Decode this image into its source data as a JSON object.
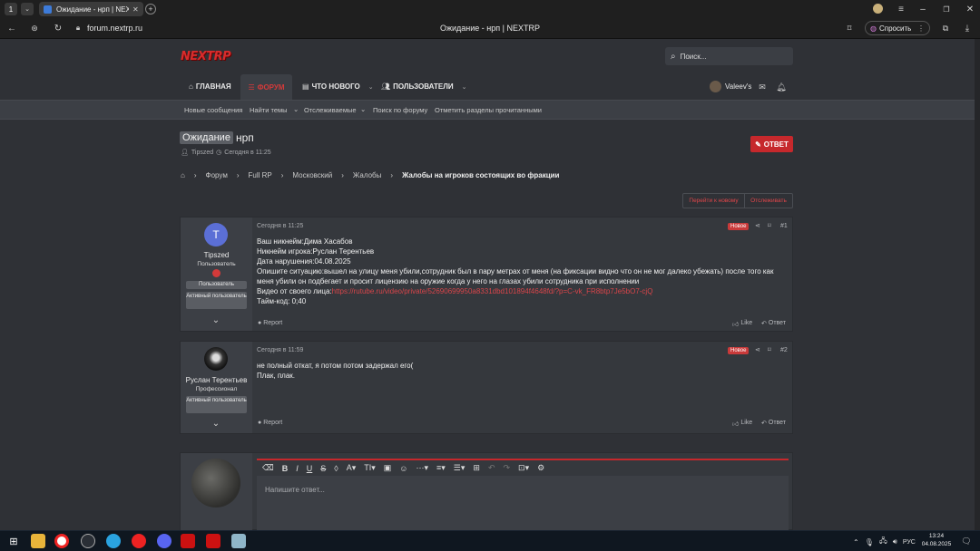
{
  "browser": {
    "tab_count": "1",
    "tab_title": "Ожидание - нрп | NEX",
    "url": "forum.nextrp.ru",
    "page_title": "Ожидание - нрп | NEXTRP",
    "ask_label": "Спросить"
  },
  "site": {
    "logo": "NEXTRP",
    "search_placeholder": "Поиск...",
    "nav": [
      {
        "label": "ГЛАВНАЯ"
      },
      {
        "label": "ФОРУМ"
      },
      {
        "label": "ЧТО НОВОГО"
      },
      {
        "label": "ПОЛЬЗОВАТЕЛИ"
      }
    ],
    "username": "Valeev's",
    "subnav": [
      "Новые сообщения",
      "Найти темы",
      "Отслеживаемые",
      "Поиск по форуму",
      "Отметить разделы прочитанными"
    ]
  },
  "thread": {
    "prefix": "Ожидание",
    "title": "нрп",
    "author": "Tipszed",
    "date": "Сегодня в 11:25",
    "reply_button": "ОТВЕТ",
    "breadcrumbs": [
      "Форум",
      "Full RP",
      "Московский",
      "Жалобы",
      "Жалобы на игроков состоящих во фракции"
    ],
    "goto_new": "Перейти к новому",
    "watch": "Отслеживать"
  },
  "posts": [
    {
      "avatar_letter": "T",
      "author": "Tipszed",
      "role": "Пользователь",
      "badges": [
        "Пользователь",
        "Активный пользователь"
      ],
      "date": "Сегодня в 11:25",
      "new_badge": "Новое",
      "number": "#1",
      "lines": [
        "Ваш никнейм:Дима Хасабов",
        "Никнейм игрока:Руслан Терентьев",
        "Дата нарушения:04.08.2025",
        "Опишите ситуацию:вышел на улицу меня убили,сотрудник был в пару метрах от меня (на фиксации видно что он не мог далеко убежать) после того как меня убили он подбегает и просит лицензию на оружие когда у него на глазах убили сотрудника при исполнении"
      ],
      "video_label": "Видео от своего лица:",
      "video_link": "https://rutube.ru/video/private/52690699950a8331dbd101894f4648fd/?p=C-vk_FR8btp7Je5bO7-cjQ",
      "timecode": "Тайм-код: 0;40",
      "report": "Report",
      "like": "Like",
      "reply": "Ответ"
    },
    {
      "author": "Руслан Терентьев",
      "role": "Профессионал",
      "badges": [
        "Активный пользователь"
      ],
      "date": "Сегодня в 11:59",
      "new_badge": "Новое",
      "number": "#2",
      "lines": [
        "не полный откат, я потом потом задержал его(",
        "Плак, плак."
      ],
      "report": "Report",
      "like": "Like",
      "reply": "Ответ"
    }
  ],
  "editor": {
    "placeholder": "Напишите ответ..."
  },
  "taskbar": {
    "lang": "РУС",
    "time": "13:24",
    "date": "04.08.2025"
  },
  "colors": {
    "accent": "#d33a3a",
    "bg": "#2f3136",
    "panel": "#35383d"
  }
}
